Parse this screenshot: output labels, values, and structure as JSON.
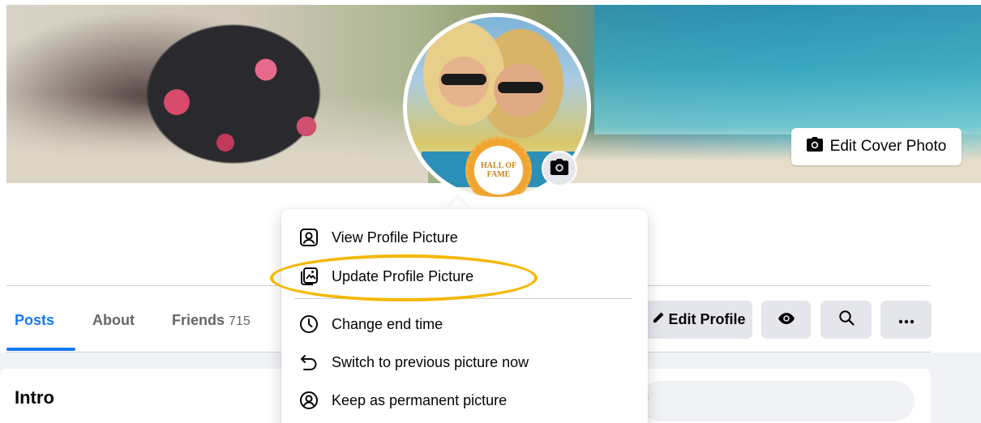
{
  "cover": {
    "edit_cover_label": "Edit Cover Photo"
  },
  "avatar": {
    "seal_line1": "HALL OF",
    "seal_line2": "FAME"
  },
  "tabs": [
    {
      "label": "Posts"
    },
    {
      "label": "About"
    },
    {
      "label": "Friends",
      "count": "715"
    }
  ],
  "actions": {
    "edit_profile_label": "Edit Profile"
  },
  "intro": {
    "title": "Intro"
  },
  "composer": {
    "placeholder_fragment": "?"
  },
  "menu": {
    "items": [
      {
        "label": "View Profile Picture",
        "icon": "portrait-icon"
      },
      {
        "label": "Update Profile Picture",
        "icon": "photo-update-icon"
      },
      {
        "label": "Change end time",
        "icon": "clock-icon"
      },
      {
        "label": "Switch to previous picture now",
        "icon": "undo-arrow-icon"
      },
      {
        "label": "Keep as permanent picture",
        "icon": "account-circle-icon"
      }
    ]
  },
  "colors": {
    "accent": "#1877f2",
    "highlight": "#f5b700",
    "button_bg": "#e4e6eb"
  }
}
